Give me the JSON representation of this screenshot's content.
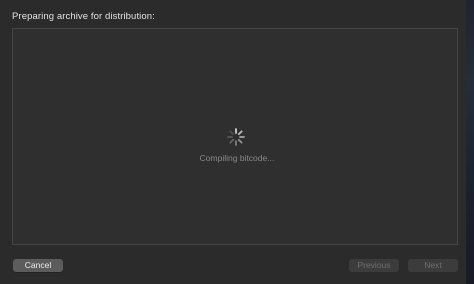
{
  "dialog": {
    "heading": "Preparing archive for distribution:",
    "status": "Compiling bitcode...",
    "spinner_icon": "spinner-icon"
  },
  "footer": {
    "cancel_label": "Cancel",
    "previous_label": "Previous",
    "next_label": "Next",
    "previous_enabled": false,
    "next_enabled": false
  },
  "colors": {
    "background": "#2b2b2b",
    "panel": "#2f2f2f",
    "text": "#e2e2e2",
    "muted_text": "#8a8a8a"
  }
}
